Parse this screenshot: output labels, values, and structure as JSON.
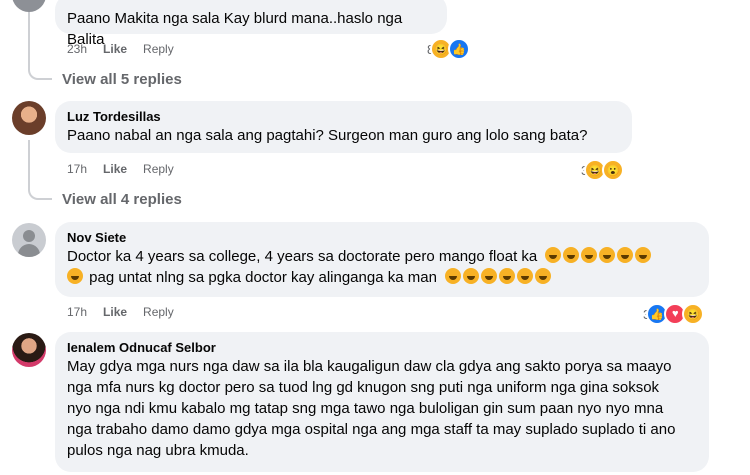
{
  "comments": [
    {
      "author": "",
      "text": "Paano Makita nga sala Kay blurd mana..haslo nga Balita",
      "time": "23h",
      "like_label": "Like",
      "reply_label": "Reply",
      "reaction_count": "8",
      "reaction_icons": [
        "haha-icon",
        "like-icon"
      ],
      "view_replies": "View all 5 replies"
    },
    {
      "author": "Luz Tordesillas",
      "text": "Paano nabal an nga sala ang pagtahi? Surgeon man guro ang lolo sang bata?",
      "time": "17h",
      "like_label": "Like",
      "reply_label": "Reply",
      "reaction_count": "3",
      "reaction_icons": [
        "haha-icon",
        "wow-icon"
      ],
      "view_replies": "View all 4 replies"
    },
    {
      "author": "Nov Siete",
      "text_line1": "Doctor ka 4 years sa college, 4 years sa doctorate pero mango float ka",
      "text_line2": "pag untat nlng sa pgka doctor kay alinganga ka man",
      "time": "17h",
      "like_label": "Like",
      "reply_label": "Reply",
      "reaction_count": "3",
      "reaction_icons": [
        "like-icon",
        "love-icon",
        "haha-icon"
      ]
    },
    {
      "author": "Ienalem Odnucaf Selbor",
      "text": "May gdya mga nurs nga daw sa ila bla kaugaligun daw cla gdya ang sakto porya sa maayo nga mfa nurs kg doctor pero sa tuod lng gd knugon sng puti nga uniform nga gina soksok nyo nga ndi kmu kabalo mg tatap sng mga tawo nga buloligan gin sum paan nyo nyo mna nga trabaho damo damo gdya mga ospital nga ang mga staff ta may suplado suplado ti ano pulos nga nag ubra kmuda."
    }
  ],
  "colors": {
    "bubble": "#f0f2f5",
    "meta": "#65676b",
    "like": "#1877f2",
    "haha": "#f7b125",
    "love": "#f33e58"
  }
}
